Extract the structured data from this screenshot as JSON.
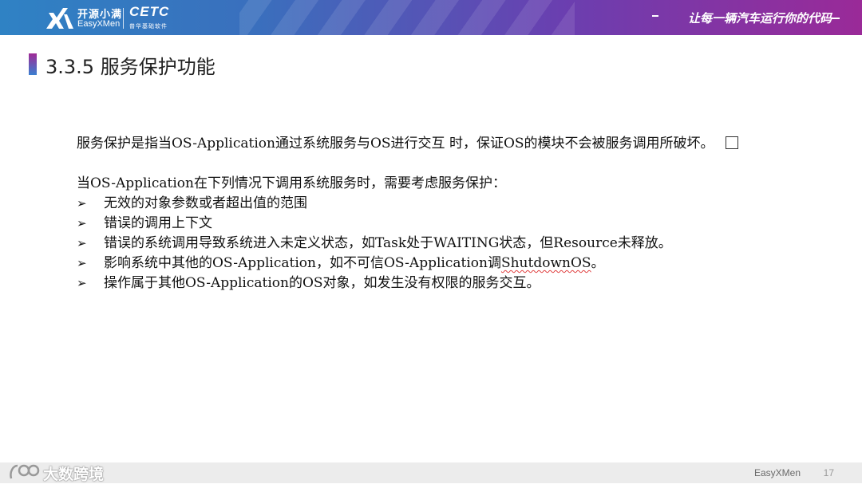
{
  "header": {
    "logo_cn": "开源小满",
    "logo_en": "EasyXMen",
    "partner": "CETC",
    "partner_sub": "普华基础软件",
    "slogan": "让每一辆汽车运行你的代码",
    "brand_color": "#3a6fbd",
    "accent_color": "#9a2a98"
  },
  "slide": {
    "title": "3.3.5 服务保护功能",
    "intro": "服务保护是指当OS-Application通过系统服务与OS进行交互 时，保证OS的模块不会被服务调用所破坏。",
    "lead": "当OS-Application在下列情况下调用系统服务时，需要考虑服务保护：",
    "bullet_symbol": "➢",
    "bullets": [
      "无效的对象参数或者超出值的范围",
      "错误的调用上下文",
      "错误的系统调用导致系统进入未定义状态，如Task处于WAITING状态，但Resource未释放。"
    ],
    "bullet4_pre": "影响系统中其他的OS-Application，如不可信OS-Application调",
    "bullet4_term": "ShutdownOS",
    "bullet4_post": "。",
    "bullet5": "操作属于其他OS-Application的OS对象，如发生没有权限的服务交互。"
  },
  "footer": {
    "brand": "EasyXMen",
    "page_number": "17",
    "watermark": "大数跨境"
  }
}
